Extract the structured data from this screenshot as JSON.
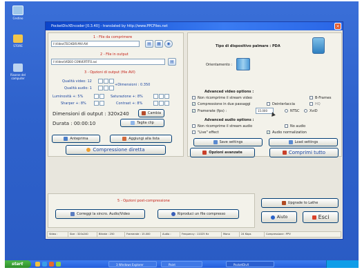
{
  "desktop": {
    "icons": [
      {
        "label": "Cestino",
        "icon": "recycle-bin-icon",
        "color": "#9fc7ea"
      },
      {
        "label": "STORE",
        "icon": "folder-icon",
        "color": "#f2c54a"
      },
      {
        "label": "Risorse del computer",
        "icon": "computer-icon",
        "color": "#bcd4f0"
      }
    ]
  },
  "taskbar": {
    "start_label": "start",
    "items": [
      "3 Windows Explorer",
      "Paint",
      "PocketDivX"
    ]
  },
  "window": {
    "title": "PocketDivXEncoder [0.3.40] - translated by http://www.PPCFiles.net"
  },
  "input_section": {
    "heading": "1 - File da comprimere",
    "path": "I:\\Video\\TECHDIR.MVI.AVI"
  },
  "output_section": {
    "heading": "2 - File in output",
    "path": "I:\\Video\\VIDEO CONVERTITO.avi"
  },
  "options_section": {
    "heading": "3 - Opzioni di output (file AVI)",
    "video_quality_label": "Qualità video: 12",
    "audio_quality_label": "Qualità audio: 1",
    "dimension_label": "+Dimensioni : 0.350",
    "brightness_label": "Luminosità +: 5%",
    "saturation_label": "Saturazione +: 8%",
    "sharpness_label": "Sharper +: 8%",
    "contrast_label": "Contrast +: 8%",
    "output_dim_label": "Dimensioni di output : 320x240",
    "change_button": "Cambia",
    "duration_label": "Durata : 00:00:10",
    "cut_button": "Taglia clip"
  },
  "device": {
    "label": "Tipo di dispositivo palmare : PDA",
    "orientation_label": "Orientamento :"
  },
  "advanced_video": {
    "heading": "Advanced video options :",
    "opt1": "Non ricomprime il stream video",
    "opt1_checked": false,
    "bframes": "B-Frames",
    "bframes_checked": false,
    "opt2": "Compressione in due passaggi",
    "opt2_checked": true,
    "deinterlace": "Deinterlaccia",
    "deinterlace_checked": false,
    "hq": "HQ",
    "hq_checked": false,
    "opt3": "Framerate (fps) :",
    "opt3_checked": true,
    "fps_value": "15.000",
    "ntsc": "NTSC",
    "xvid": "XviD"
  },
  "advanced_audio": {
    "heading": "Advanced audio options :",
    "opt1": "Non ricomprime il stream audio",
    "opt1_checked": false,
    "no_audio": "No audio",
    "no_audio_checked": false,
    "opt2": "\"Live\" effect",
    "opt2_checked": false,
    "normalize": "Audio normalization",
    "normalize_checked": true
  },
  "buttons": {
    "preview": "Anteprima",
    "add_list": "Aggiungi alla lista",
    "direct": "Compressione diretta",
    "save_settings": "Save settings",
    "load_settings": "Load settings",
    "advanced": "Opzioni avanzate",
    "compress_all": "Comprimi tutto"
  },
  "post_section": {
    "heading": "5 - Opzioni post-compressione",
    "sync_button": "Correggi la sincro. Audio/Video",
    "play_button": "Riproduci un file compresso"
  },
  "side_buttons": {
    "upgrade": "Upgrade to Lathe",
    "help": "Aiuto",
    "exit": "Esci"
  },
  "statusbar": {
    "cells": [
      "Video :",
      "Size : 320x240",
      "Bitrate : 250",
      "Framerate : 15.000",
      "Audio :",
      "Frequency : 11025 Hz",
      "Mono",
      "24 Kbps",
      "Compressione : PPV"
    ]
  },
  "colors": {
    "title_bar": "#0b44c9",
    "desktop": "#2f62cc",
    "accent_red": "#c42016",
    "accent_blue": "#1c46a0"
  }
}
